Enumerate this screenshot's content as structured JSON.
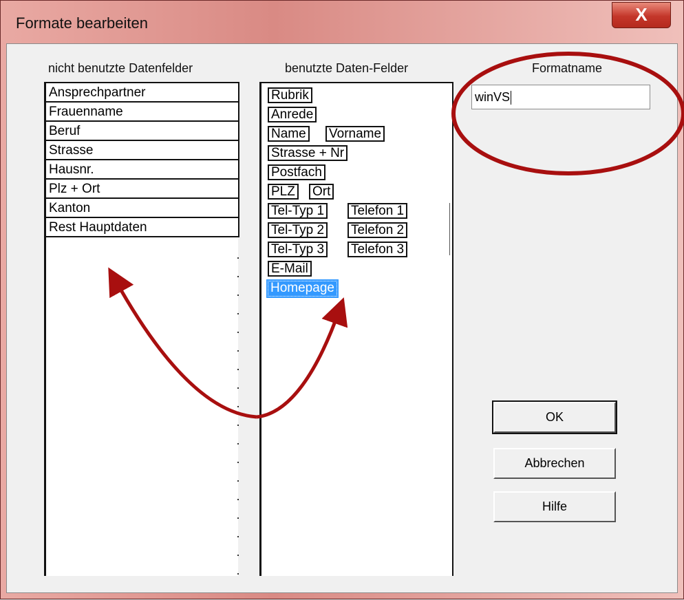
{
  "window": {
    "title": "Formate bearbeiten",
    "close_label": "X"
  },
  "headers": {
    "unused": "nicht benutzte Datenfelder",
    "used": "benutzte Daten-Felder",
    "formatname": "Formatname"
  },
  "unused_fields": [
    "Ansprechpartner",
    "Frauenname",
    "Beruf",
    "Strasse",
    "Hausnr.",
    "Plz + Ort",
    "Kanton",
    "Rest Hauptdaten"
  ],
  "used_fields": {
    "rubrik": "Rubrik",
    "anrede": "Anrede",
    "name": "Name",
    "vorname": "Vorname",
    "strasse_nr": "Strasse + Nr",
    "postfach": "Postfach",
    "plz": "PLZ",
    "ort": "Ort",
    "teltyp1": "Tel-Typ 1",
    "telefon1": "Telefon 1",
    "teltyp2": "Tel-Typ 2",
    "telefon2": "Telefon 2",
    "teltyp3": "Tel-Typ 3",
    "telefon3": "Telefon 3",
    "email": "E-Mail",
    "homepage": "Homepage"
  },
  "formatname_value": "winVS",
  "buttons": {
    "ok": "OK",
    "cancel": "Abbrechen",
    "help": "Hilfe"
  },
  "annotation_colors": {
    "circle": "#a80f0f",
    "arrow": "#a80f0f"
  }
}
